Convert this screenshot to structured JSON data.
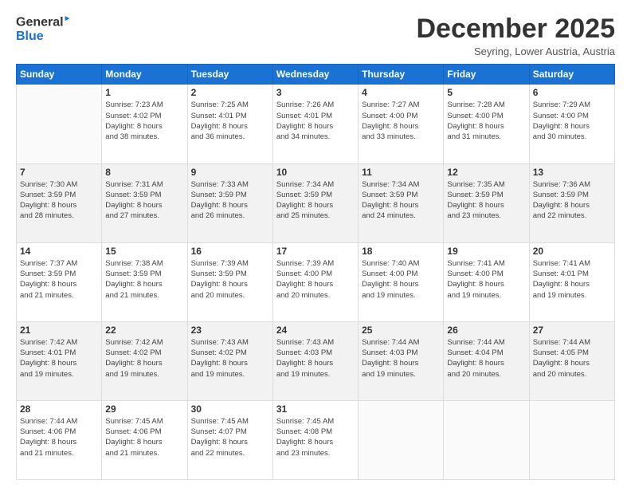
{
  "header": {
    "logo_line1": "General",
    "logo_line2": "Blue",
    "month": "December 2025",
    "location": "Seyring, Lower Austria, Austria"
  },
  "weekdays": [
    "Sunday",
    "Monday",
    "Tuesday",
    "Wednesday",
    "Thursday",
    "Friday",
    "Saturday"
  ],
  "weeks": [
    [
      {
        "num": "",
        "info": ""
      },
      {
        "num": "1",
        "info": "Sunrise: 7:23 AM\nSunset: 4:02 PM\nDaylight: 8 hours\nand 38 minutes."
      },
      {
        "num": "2",
        "info": "Sunrise: 7:25 AM\nSunset: 4:01 PM\nDaylight: 8 hours\nand 36 minutes."
      },
      {
        "num": "3",
        "info": "Sunrise: 7:26 AM\nSunset: 4:01 PM\nDaylight: 8 hours\nand 34 minutes."
      },
      {
        "num": "4",
        "info": "Sunrise: 7:27 AM\nSunset: 4:00 PM\nDaylight: 8 hours\nand 33 minutes."
      },
      {
        "num": "5",
        "info": "Sunrise: 7:28 AM\nSunset: 4:00 PM\nDaylight: 8 hours\nand 31 minutes."
      },
      {
        "num": "6",
        "info": "Sunrise: 7:29 AM\nSunset: 4:00 PM\nDaylight: 8 hours\nand 30 minutes."
      }
    ],
    [
      {
        "num": "7",
        "info": "Sunrise: 7:30 AM\nSunset: 3:59 PM\nDaylight: 8 hours\nand 28 minutes."
      },
      {
        "num": "8",
        "info": "Sunrise: 7:31 AM\nSunset: 3:59 PM\nDaylight: 8 hours\nand 27 minutes."
      },
      {
        "num": "9",
        "info": "Sunrise: 7:33 AM\nSunset: 3:59 PM\nDaylight: 8 hours\nand 26 minutes."
      },
      {
        "num": "10",
        "info": "Sunrise: 7:34 AM\nSunset: 3:59 PM\nDaylight: 8 hours\nand 25 minutes."
      },
      {
        "num": "11",
        "info": "Sunrise: 7:34 AM\nSunset: 3:59 PM\nDaylight: 8 hours\nand 24 minutes."
      },
      {
        "num": "12",
        "info": "Sunrise: 7:35 AM\nSunset: 3:59 PM\nDaylight: 8 hours\nand 23 minutes."
      },
      {
        "num": "13",
        "info": "Sunrise: 7:36 AM\nSunset: 3:59 PM\nDaylight: 8 hours\nand 22 minutes."
      }
    ],
    [
      {
        "num": "14",
        "info": "Sunrise: 7:37 AM\nSunset: 3:59 PM\nDaylight: 8 hours\nand 21 minutes."
      },
      {
        "num": "15",
        "info": "Sunrise: 7:38 AM\nSunset: 3:59 PM\nDaylight: 8 hours\nand 21 minutes."
      },
      {
        "num": "16",
        "info": "Sunrise: 7:39 AM\nSunset: 3:59 PM\nDaylight: 8 hours\nand 20 minutes."
      },
      {
        "num": "17",
        "info": "Sunrise: 7:39 AM\nSunset: 4:00 PM\nDaylight: 8 hours\nand 20 minutes."
      },
      {
        "num": "18",
        "info": "Sunrise: 7:40 AM\nSunset: 4:00 PM\nDaylight: 8 hours\nand 19 minutes."
      },
      {
        "num": "19",
        "info": "Sunrise: 7:41 AM\nSunset: 4:00 PM\nDaylight: 8 hours\nand 19 minutes."
      },
      {
        "num": "20",
        "info": "Sunrise: 7:41 AM\nSunset: 4:01 PM\nDaylight: 8 hours\nand 19 minutes."
      }
    ],
    [
      {
        "num": "21",
        "info": "Sunrise: 7:42 AM\nSunset: 4:01 PM\nDaylight: 8 hours\nand 19 minutes."
      },
      {
        "num": "22",
        "info": "Sunrise: 7:42 AM\nSunset: 4:02 PM\nDaylight: 8 hours\nand 19 minutes."
      },
      {
        "num": "23",
        "info": "Sunrise: 7:43 AM\nSunset: 4:02 PM\nDaylight: 8 hours\nand 19 minutes."
      },
      {
        "num": "24",
        "info": "Sunrise: 7:43 AM\nSunset: 4:03 PM\nDaylight: 8 hours\nand 19 minutes."
      },
      {
        "num": "25",
        "info": "Sunrise: 7:44 AM\nSunset: 4:03 PM\nDaylight: 8 hours\nand 19 minutes."
      },
      {
        "num": "26",
        "info": "Sunrise: 7:44 AM\nSunset: 4:04 PM\nDaylight: 8 hours\nand 20 minutes."
      },
      {
        "num": "27",
        "info": "Sunrise: 7:44 AM\nSunset: 4:05 PM\nDaylight: 8 hours\nand 20 minutes."
      }
    ],
    [
      {
        "num": "28",
        "info": "Sunrise: 7:44 AM\nSunset: 4:06 PM\nDaylight: 8 hours\nand 21 minutes."
      },
      {
        "num": "29",
        "info": "Sunrise: 7:45 AM\nSunset: 4:06 PM\nDaylight: 8 hours\nand 21 minutes."
      },
      {
        "num": "30",
        "info": "Sunrise: 7:45 AM\nSunset: 4:07 PM\nDaylight: 8 hours\nand 22 minutes."
      },
      {
        "num": "31",
        "info": "Sunrise: 7:45 AM\nSunset: 4:08 PM\nDaylight: 8 hours\nand 23 minutes."
      },
      {
        "num": "",
        "info": ""
      },
      {
        "num": "",
        "info": ""
      },
      {
        "num": "",
        "info": ""
      }
    ]
  ]
}
